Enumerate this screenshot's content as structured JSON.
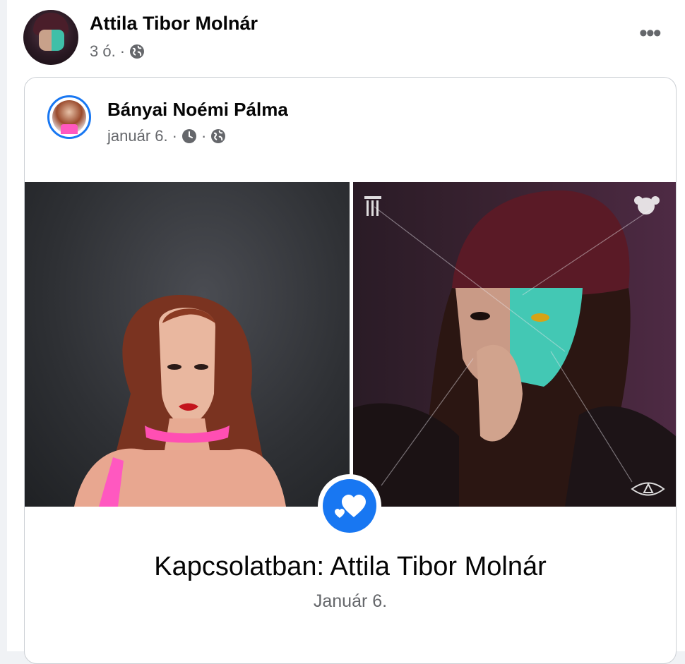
{
  "post": {
    "author": "Attila Tibor Molnár",
    "time": "3 ó.",
    "privacy_icon": "globe-icon",
    "more_icon": "more-horizontal-icon"
  },
  "shared_post": {
    "author": "Bányai Noémi Pálma",
    "date": "január 6.",
    "scheduled_icon": "clock-icon",
    "privacy_icon": "globe-icon"
  },
  "life_event": {
    "icon": "hearts-icon",
    "title": "Kapcsolatban: Attila Tibor Molnár",
    "date": "Január 6."
  },
  "colors": {
    "accent": "#1877f2",
    "text_primary": "#050505",
    "text_secondary": "#65676b"
  }
}
